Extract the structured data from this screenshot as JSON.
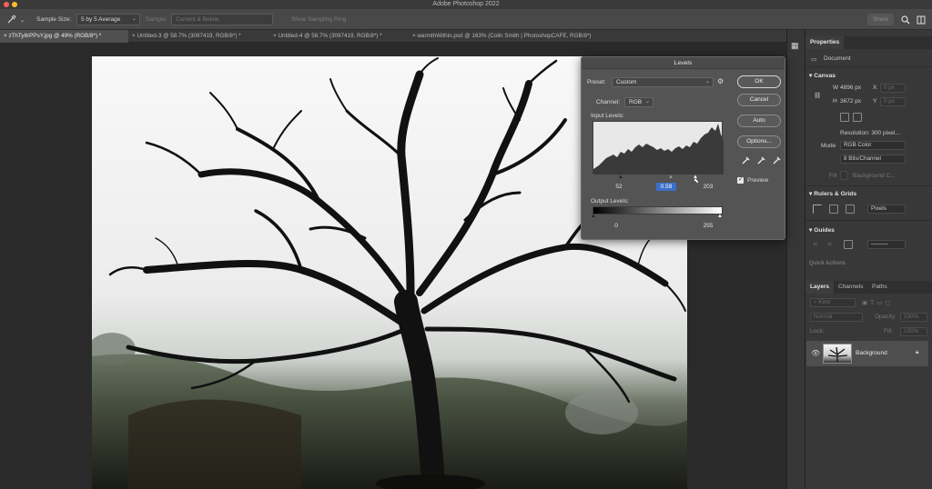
{
  "app": {
    "title": "Adobe Photoshop 2022"
  },
  "options_bar": {
    "tool_icon": "eyedropper-icon",
    "sample_size_label": "Sample Size:",
    "sample_size_value": "5 by 5 Average",
    "sample_label": "Sample:",
    "sample_value": "Current & Below",
    "show_ring_label": "Show Sampling Ring",
    "share_label": "Share",
    "search_icon": "search-icon",
    "workspace_icon": "workspace-icon"
  },
  "tabs": [
    {
      "label": "zThTy8rPPsY.jpg @ 49% (RGB/8*) *",
      "active": true
    },
    {
      "label": "Untitled-3 @ 58.7% (3097419, RGB/8*) *",
      "active": false
    },
    {
      "label": "Untitled-4 @ 58.7% (3097419, RGB/8*) *",
      "active": false
    },
    {
      "label": "warmthWithin.psd @ 163% (Colin Smith | PhotoshopCAFE, RGB/8*)",
      "active": false
    }
  ],
  "levels": {
    "title": "Levels",
    "preset_label": "Preset:",
    "preset_value": "Custom",
    "channel_label": "Channel:",
    "channel_value": "RGB",
    "input_levels_label": "Input Levels:",
    "input_black": "52",
    "input_gamma": "0.59",
    "input_white": "203",
    "output_levels_label": "Output Levels:",
    "output_black": "0",
    "output_white": "255",
    "ok_label": "OK",
    "cancel_label": "Cancel",
    "auto_label": "Auto",
    "options_label": "Options...",
    "preview_label": "Preview",
    "preview_checked": true
  },
  "properties": {
    "tabs": [
      "Properties"
    ],
    "document_label": "Document",
    "canvas_header": "Canvas",
    "w_label": "W",
    "w_value": "4896 px",
    "h_label": "H",
    "h_value": "3672 px",
    "x_label": "X",
    "y_label": "Y",
    "x_value": "0 px",
    "y_value": "0 px",
    "resolution": "Resolution: 300 pixel...",
    "mode_label": "Mode",
    "mode_value": "RGB Color",
    "bits_value": "8 Bits/Channel",
    "fill_label": "Fill",
    "fill_value": "Background C...",
    "rulers_header": "Rulers & Grids",
    "units_value": "Pixels",
    "guides_header": "Guides",
    "quick_actions_header": "Quick Actions"
  },
  "layers": {
    "tabs": [
      "Layers",
      "Channels",
      "Paths"
    ],
    "kind_label": "Kind",
    "blend_value": "Normal",
    "opacity_label": "Opacity:",
    "opacity_value": "100%",
    "lock_label": "Lock:",
    "fill_label": "Fill:",
    "fill_value": "100%",
    "layer_name": "Background"
  },
  "colors": {
    "accent": "#3b6fc9",
    "close": "#ff5f57",
    "minimize": "#febc2e",
    "maximize": "#28c840"
  }
}
